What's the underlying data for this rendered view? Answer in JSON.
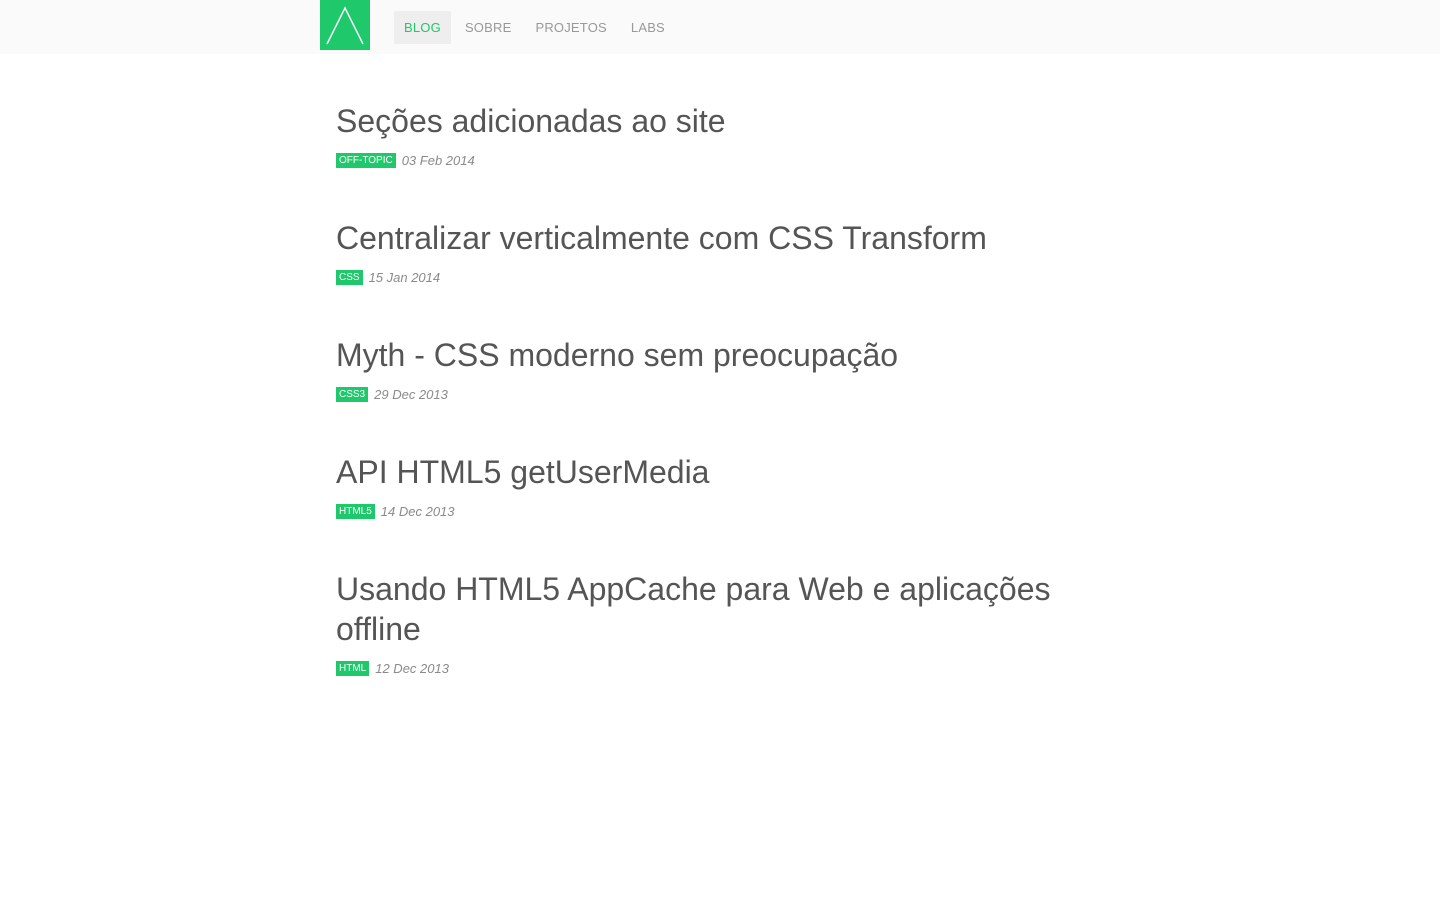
{
  "nav": {
    "items": [
      {
        "label": "BLOG",
        "active": true
      },
      {
        "label": "SOBRE",
        "active": false
      },
      {
        "label": "PROJETOS",
        "active": false
      },
      {
        "label": "LABS",
        "active": false
      }
    ]
  },
  "posts": [
    {
      "title": "Seções adicionadas ao site",
      "tag": "OFF-TOPIC",
      "date": "03 Feb 2014"
    },
    {
      "title": "Centralizar verticalmente com CSS Transform",
      "tag": "CSS",
      "date": "15 Jan 2014"
    },
    {
      "title": "Myth - CSS moderno sem preocupação",
      "tag": "CSS3",
      "date": "29 Dec 2013"
    },
    {
      "title": "API HTML5 getUserMedia",
      "tag": "HTML5",
      "date": "14 Dec 2013"
    },
    {
      "title": "Usando HTML5 AppCache para Web e aplicações offline",
      "tag": "HTML",
      "date": "12 Dec 2013"
    }
  ],
  "colors": {
    "accent": "#1fc96b",
    "topbar": "#fafafa",
    "text": "#555555",
    "muted": "#999999"
  },
  "icons": {
    "logo": "logo-icon"
  }
}
